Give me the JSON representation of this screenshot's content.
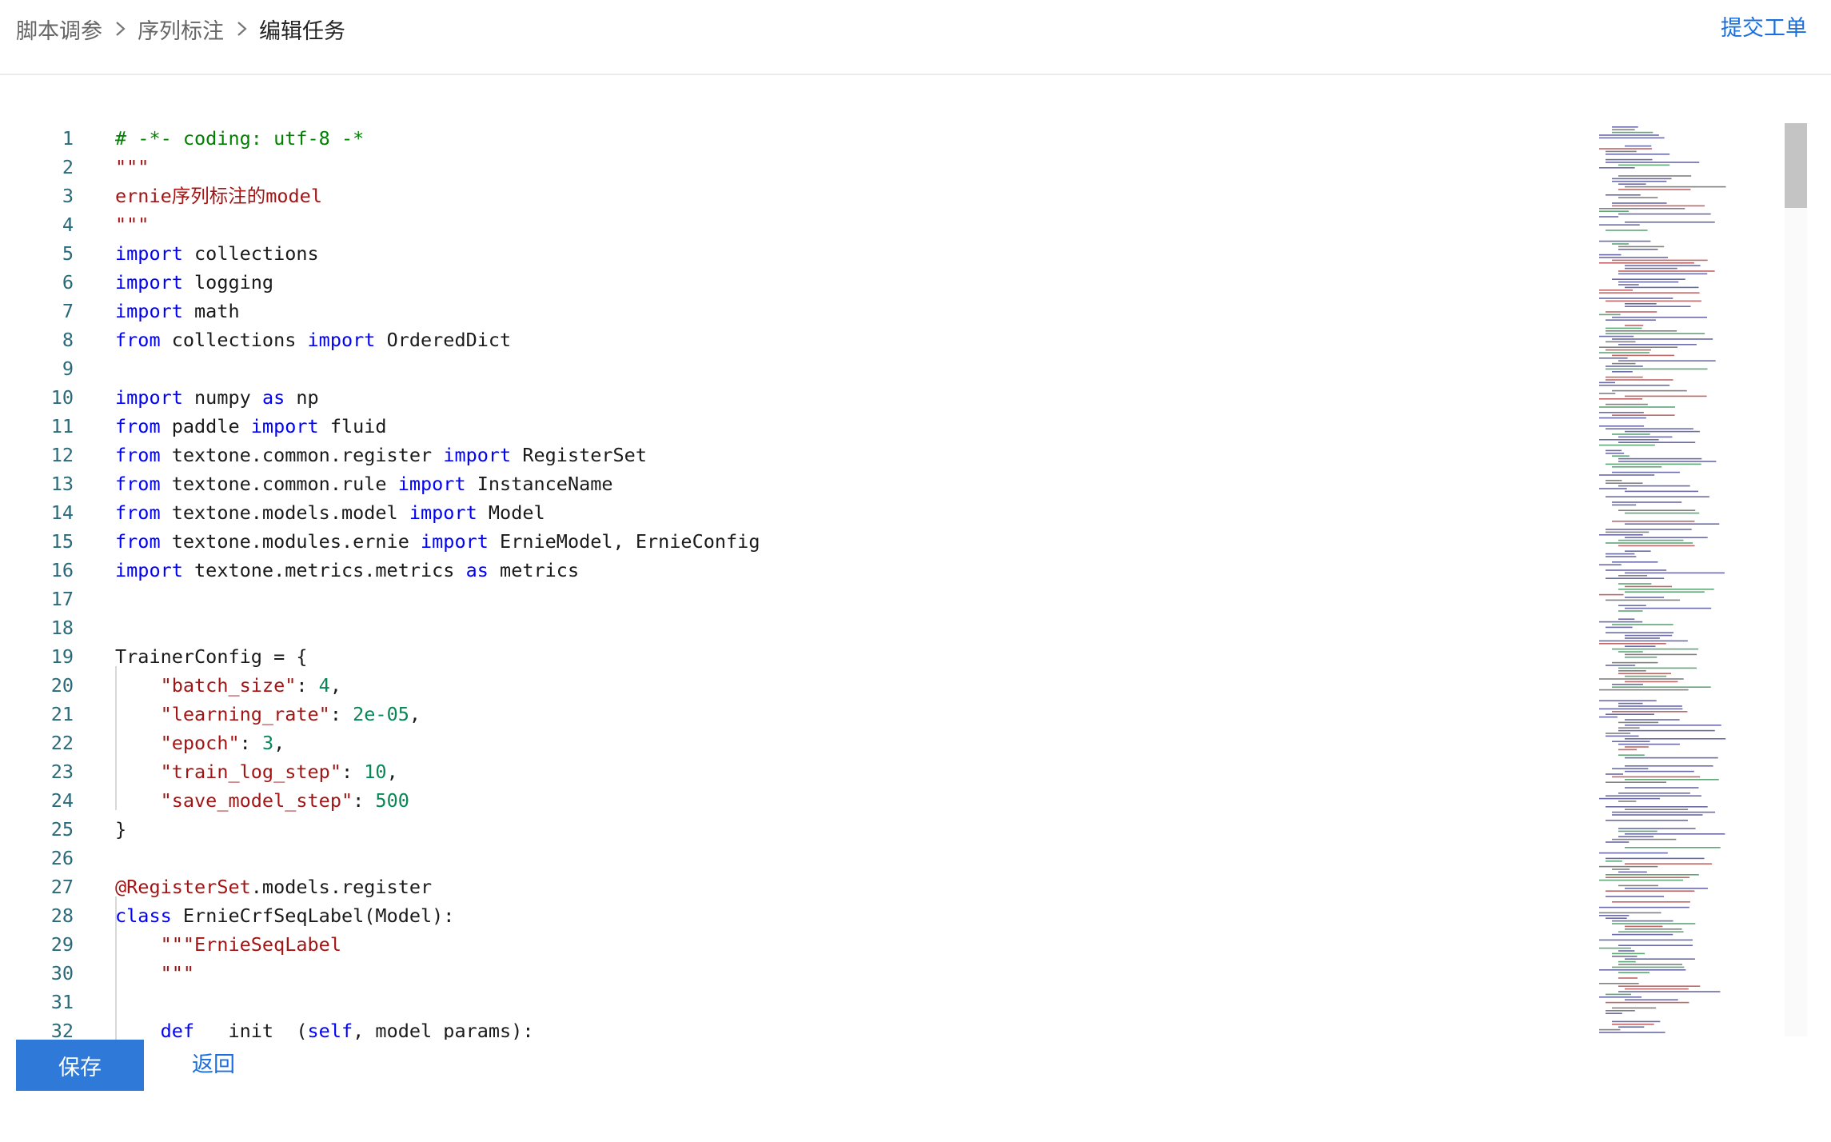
{
  "breadcrumb": {
    "items": [
      "脚本调参",
      "序列标注",
      "编辑任务"
    ]
  },
  "header": {
    "submit_label": "提交工单"
  },
  "editor": {
    "lines": [
      [
        [
          "# -*- coding: utf-8 -*",
          "cmt"
        ]
      ],
      [
        [
          "\"\"\"",
          "str"
        ]
      ],
      [
        [
          "ernie序列标注的model",
          "str"
        ]
      ],
      [
        [
          "\"\"\"",
          "str"
        ]
      ],
      [
        [
          "import",
          "kw"
        ],
        [
          " collections",
          ""
        ]
      ],
      [
        [
          "import",
          "kw"
        ],
        [
          " logging",
          ""
        ]
      ],
      [
        [
          "import",
          "kw"
        ],
        [
          " math",
          ""
        ]
      ],
      [
        [
          "from",
          "kw"
        ],
        [
          " collections ",
          ""
        ],
        [
          "import",
          "kw"
        ],
        [
          " OrderedDict",
          ""
        ]
      ],
      [],
      [
        [
          "import",
          "kw"
        ],
        [
          " numpy ",
          ""
        ],
        [
          "as",
          "kw"
        ],
        [
          " np",
          ""
        ]
      ],
      [
        [
          "from",
          "kw"
        ],
        [
          " paddle ",
          ""
        ],
        [
          "import",
          "kw"
        ],
        [
          " fluid",
          ""
        ]
      ],
      [
        [
          "from",
          "kw"
        ],
        [
          " textone.common.register ",
          ""
        ],
        [
          "import",
          "kw"
        ],
        [
          " RegisterSet",
          ""
        ]
      ],
      [
        [
          "from",
          "kw"
        ],
        [
          " textone.common.rule ",
          ""
        ],
        [
          "import",
          "kw"
        ],
        [
          " InstanceName",
          ""
        ]
      ],
      [
        [
          "from",
          "kw"
        ],
        [
          " textone.models.model ",
          ""
        ],
        [
          "import",
          "kw"
        ],
        [
          " Model",
          ""
        ]
      ],
      [
        [
          "from",
          "kw"
        ],
        [
          " textone.modules.ernie ",
          ""
        ],
        [
          "import",
          "kw"
        ],
        [
          " ErnieModel, ErnieConfig",
          ""
        ]
      ],
      [
        [
          "import",
          "kw"
        ],
        [
          " textone.metrics.metrics ",
          ""
        ],
        [
          "as",
          "kw"
        ],
        [
          " metrics",
          ""
        ]
      ],
      [],
      [],
      [
        [
          "TrainerConfig = {",
          ""
        ]
      ],
      [
        [
          "    ",
          ""
        ],
        [
          "\"batch_size\"",
          "str"
        ],
        [
          ": ",
          ""
        ],
        [
          "4",
          "num"
        ],
        [
          ",",
          ""
        ]
      ],
      [
        [
          "    ",
          ""
        ],
        [
          "\"learning_rate\"",
          "str"
        ],
        [
          ": ",
          ""
        ],
        [
          "2e-05",
          "num"
        ],
        [
          ",",
          ""
        ]
      ],
      [
        [
          "    ",
          ""
        ],
        [
          "\"epoch\"",
          "str"
        ],
        [
          ": ",
          ""
        ],
        [
          "3",
          "num"
        ],
        [
          ",",
          ""
        ]
      ],
      [
        [
          "    ",
          ""
        ],
        [
          "\"train_log_step\"",
          "str"
        ],
        [
          ": ",
          ""
        ],
        [
          "10",
          "num"
        ],
        [
          ",",
          ""
        ]
      ],
      [
        [
          "    ",
          ""
        ],
        [
          "\"save_model_step\"",
          "str"
        ],
        [
          ": ",
          ""
        ],
        [
          "500",
          "num"
        ]
      ],
      [
        [
          "}",
          ""
        ]
      ],
      [],
      [
        [
          "@RegisterSet",
          "dec"
        ],
        [
          ".models.register",
          ""
        ]
      ],
      [
        [
          "class",
          "kw"
        ],
        [
          " ErnieCrfSeqLabel(Model):",
          ""
        ]
      ],
      [
        [
          "    ",
          ""
        ],
        [
          "\"\"\"ErnieSeqLabel",
          "str"
        ]
      ],
      [
        [
          "    ",
          ""
        ],
        [
          "\"\"\"",
          "str"
        ]
      ],
      [],
      [
        [
          "    ",
          ""
        ],
        [
          "def",
          "kw"
        ],
        [
          " __init__(",
          ""
        ],
        [
          "self",
          "kw"
        ],
        [
          ", model_params):",
          ""
        ]
      ]
    ]
  },
  "footer": {
    "save_label": "保存",
    "back_label": "返回"
  }
}
